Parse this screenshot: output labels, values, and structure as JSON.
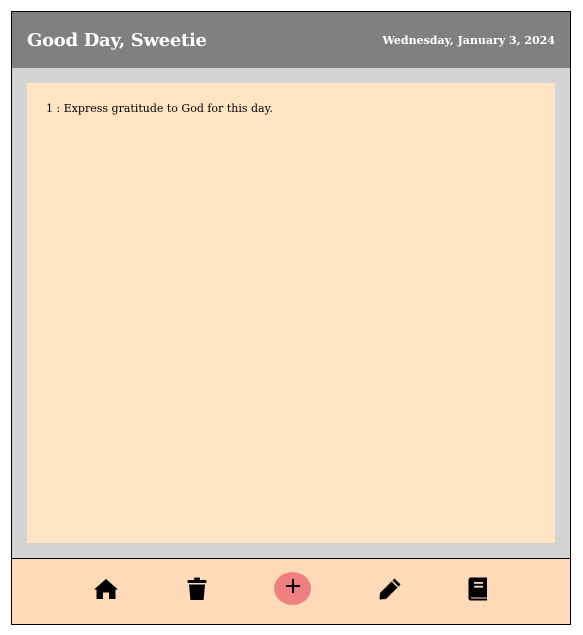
{
  "header": {
    "greeting": "Good Day, Sweetie",
    "date": "Wednesday, January 3, 2024"
  },
  "tasks": [
    {
      "number": "1",
      "text": "1 : Express gratitude to God for this day."
    }
  ],
  "toolbar": {
    "home_icon": "home-icon",
    "delete_icon": "trash-icon",
    "add_icon": "plus-icon",
    "add_symbol": "+",
    "edit_icon": "pencil-icon",
    "journal_icon": "book-icon"
  },
  "colors": {
    "header_bg": "#808080",
    "page_bg": "#d4d4d4",
    "note_bg": "#ffe4c4",
    "footer_bg": "#ffdab9",
    "add_button": "#f08080"
  }
}
